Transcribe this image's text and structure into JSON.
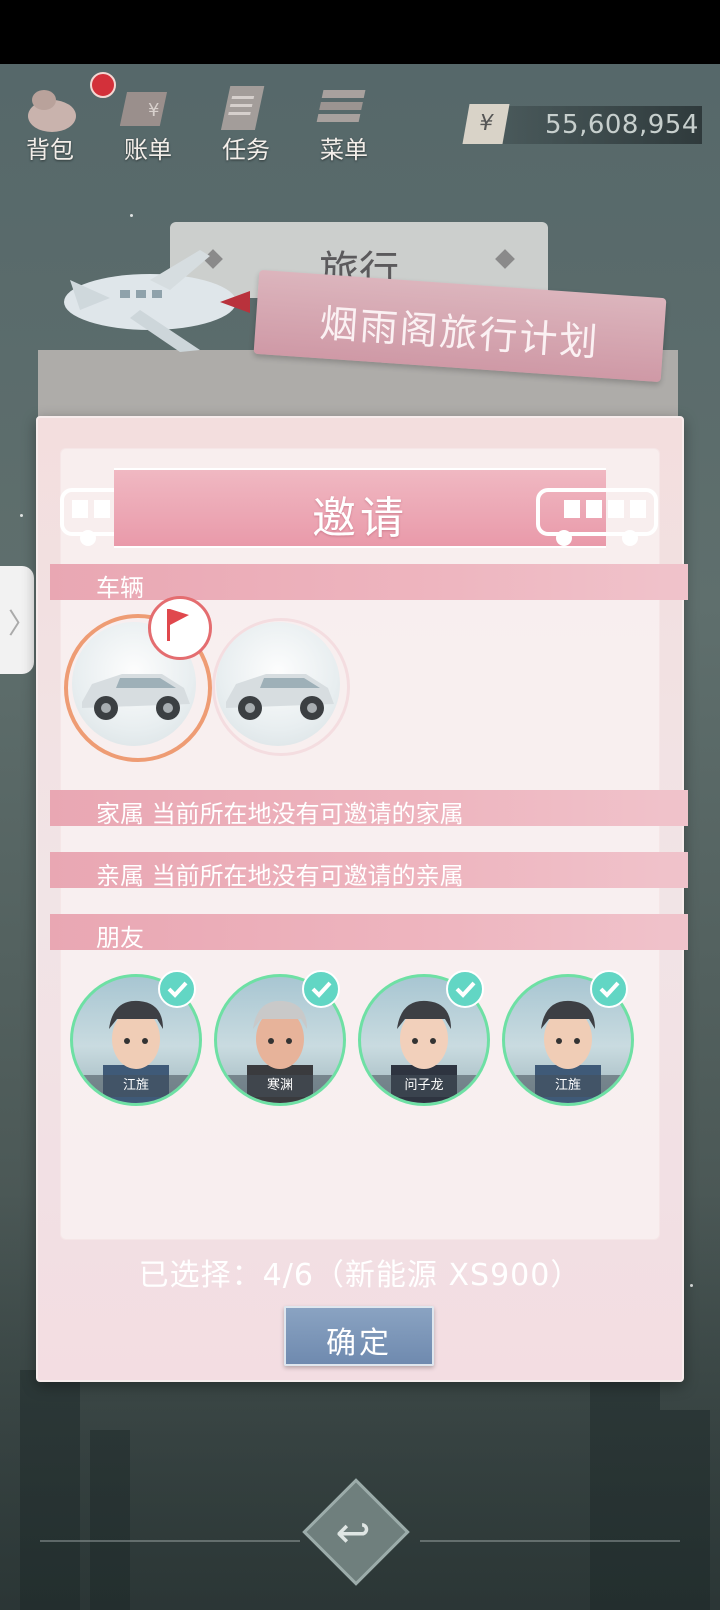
{
  "hud": {
    "items": [
      {
        "label": "背包",
        "icon": "backpack-icon",
        "has_badge": true
      },
      {
        "label": "账单",
        "icon": "bill-icon",
        "has_badge": false
      },
      {
        "label": "任务",
        "icon": "task-icon",
        "has_badge": false
      },
      {
        "label": "菜单",
        "icon": "menu-icon",
        "has_badge": false
      }
    ],
    "currency_symbol": "¥",
    "money": "55,608,954"
  },
  "travel": {
    "title": "旅行",
    "plan": "烟雨阁旅行计划"
  },
  "dialog": {
    "title": "邀请",
    "sections": {
      "vehicles": "车辆",
      "family": "家属 当前所在地没有可邀请的家属",
      "relatives": "亲属 当前所在地没有可邀请的亲属",
      "friends": "朋友"
    },
    "vehicles": [
      {
        "icon": "suv-car-icon",
        "selected": true,
        "flag": true
      },
      {
        "icon": "suv-car-icon",
        "selected": false,
        "flag": false
      }
    ],
    "friends": [
      {
        "name": "江旌",
        "checked": true,
        "hair": "#3d3f44"
      },
      {
        "name": "寒渊",
        "checked": true,
        "hair": "#c9c9c9"
      },
      {
        "name": "问子龙",
        "checked": true,
        "hair": "#3d3f44"
      },
      {
        "name": "江旌",
        "checked": true,
        "hair": "#3d3f44"
      }
    ],
    "selected_summary": "已选择：4/6（新能源 XS900）",
    "confirm_label": "确定"
  },
  "colors": {
    "accent_pink": "#e99aaa",
    "check_teal": "#62d6c4",
    "ring_green": "#6ee0a4",
    "confirm_blue": "#7d97ba"
  }
}
